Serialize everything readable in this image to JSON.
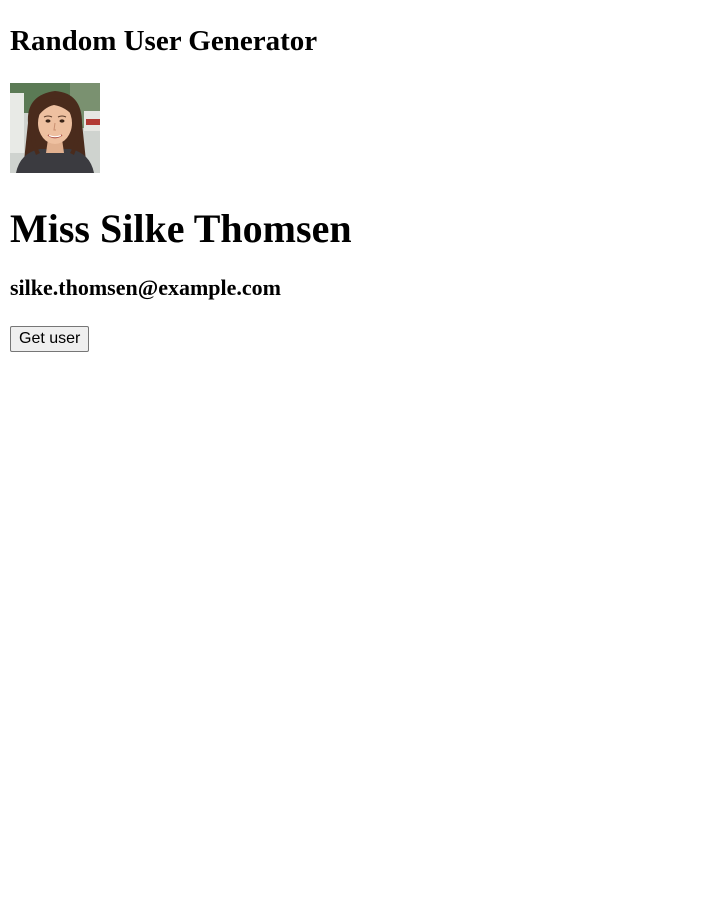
{
  "app": {
    "title": "Random User Generator"
  },
  "user": {
    "avatar_alt": "User avatar photo",
    "name": "Miss Silke Thomsen",
    "email": "silke.thomsen@example.com"
  },
  "actions": {
    "get_user_label": "Get user"
  }
}
